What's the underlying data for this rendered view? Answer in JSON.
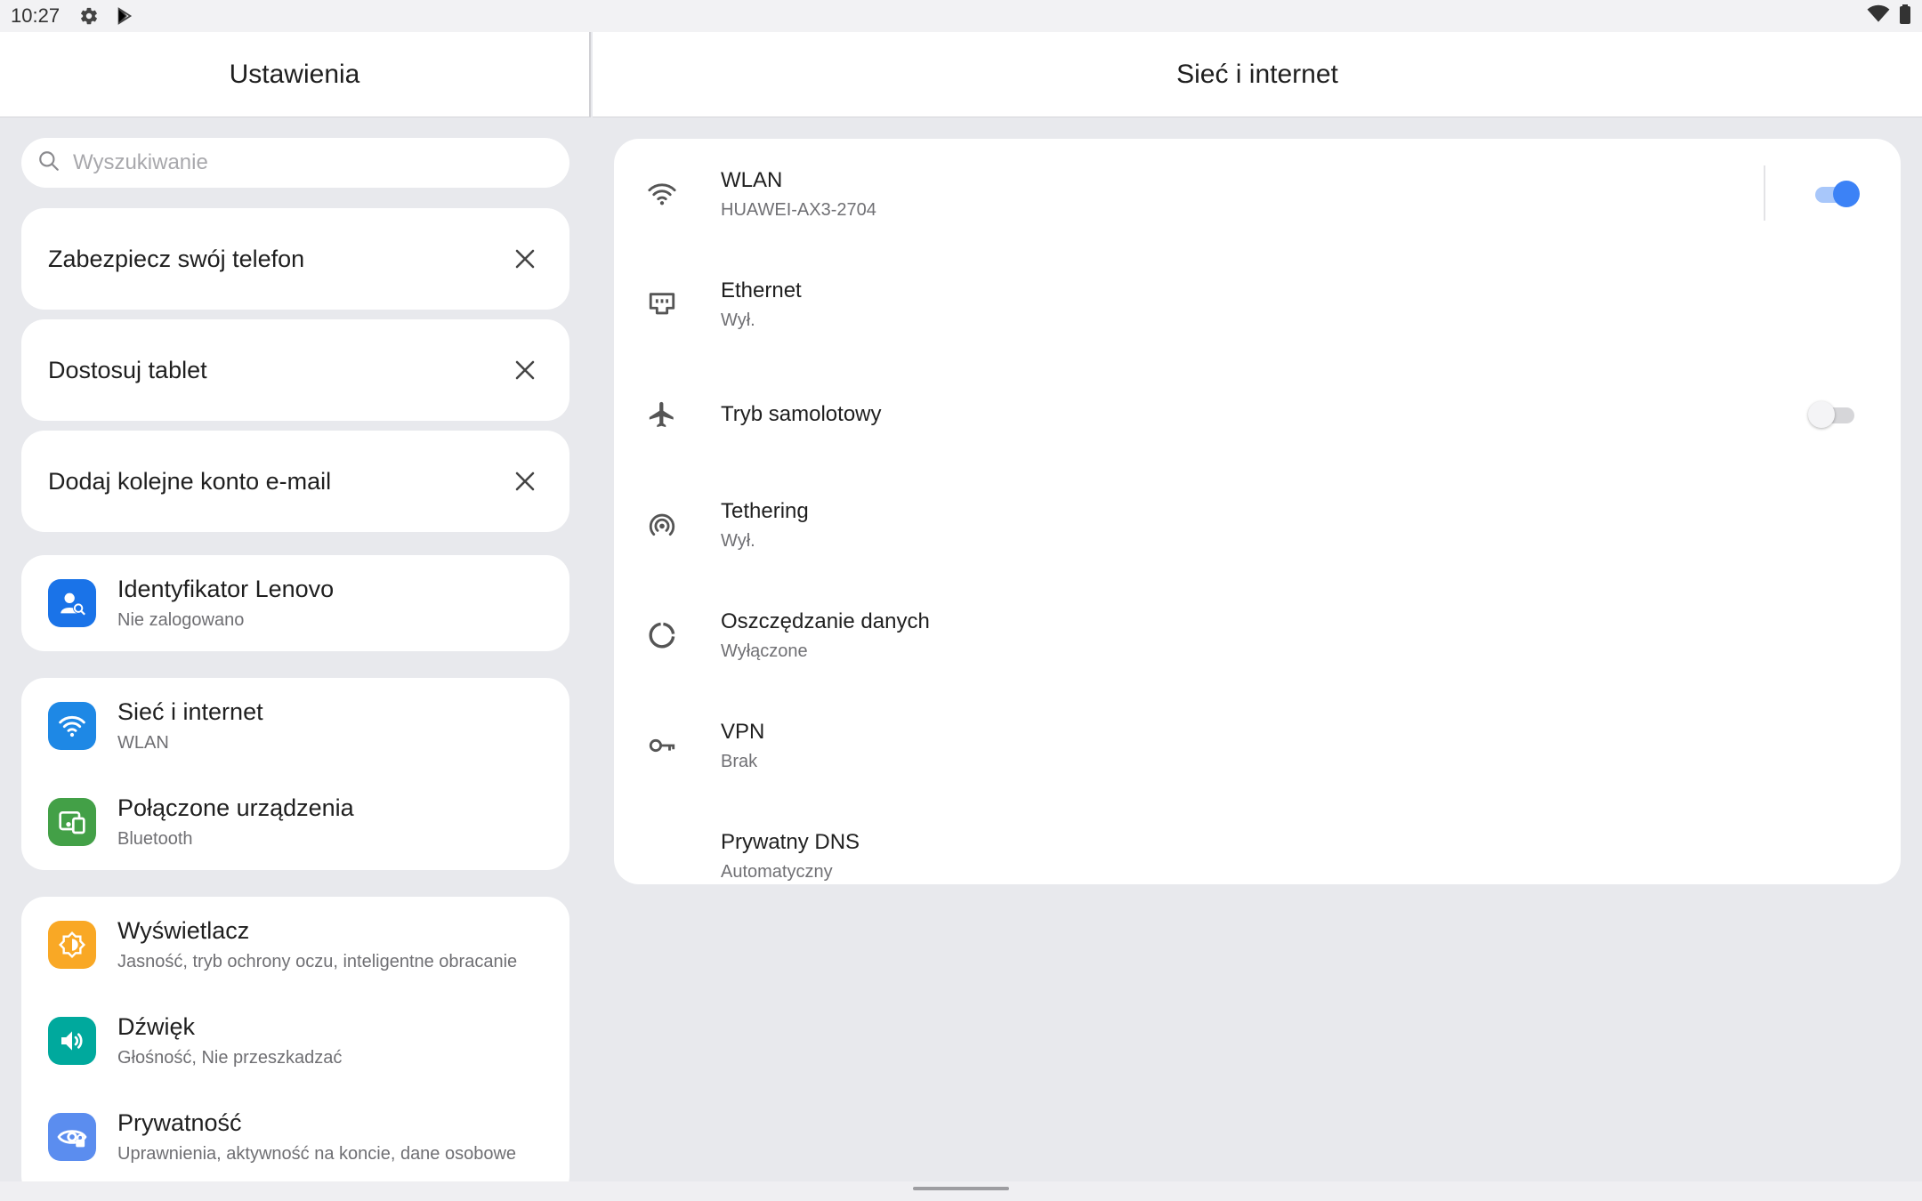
{
  "status_bar": {
    "time": "10:27",
    "icons_left": [
      "gear-icon",
      "play-store-icon"
    ],
    "icons_right": [
      "wifi-icon",
      "battery-icon"
    ]
  },
  "left_header": {
    "title": "Ustawienia"
  },
  "right_header": {
    "title": "Sieć i internet"
  },
  "search": {
    "placeholder": "Wyszukiwanie"
  },
  "suggestions": [
    {
      "label": "Zabezpiecz swój telefon"
    },
    {
      "label": "Dostosuj tablet"
    },
    {
      "label": "Dodaj kolejne konto e-mail"
    }
  ],
  "account": {
    "title": "Identyfikator Lenovo",
    "subtitle": "Nie zalogowano",
    "icon": "lenovo-id-icon",
    "color": "#1a73e8"
  },
  "group1": [
    {
      "title": "Sieć i internet",
      "subtitle": "WLAN",
      "icon": "wifi-icon",
      "color": "#1e88e5"
    },
    {
      "title": "Połączone urządzenia",
      "subtitle": "Bluetooth",
      "icon": "connected-devices-icon",
      "color": "#43a047"
    }
  ],
  "group2": [
    {
      "title": "Wyświetlacz",
      "subtitle": "Jasność, tryb ochrony oczu, inteligentne obracanie",
      "icon": "display-icon",
      "color": "#f9a825"
    },
    {
      "title": "Dźwięk",
      "subtitle": "Głośność, Nie przeszkadzać",
      "icon": "sound-icon",
      "color": "#00a99d"
    },
    {
      "title": "Prywatność",
      "subtitle": "Uprawnienia, aktywność na koncie, dane osobowe",
      "icon": "privacy-icon",
      "color": "#5b8def"
    }
  ],
  "network_items": [
    {
      "title": "WLAN",
      "subtitle": "HUAWEI-AX3-2704",
      "icon": "wifi-icon",
      "toggle": true
    },
    {
      "title": "Ethernet",
      "subtitle": "Wył.",
      "icon": "ethernet-icon"
    },
    {
      "title": "Tryb samolotowy",
      "subtitle": "",
      "icon": "airplane-icon",
      "toggle": false
    },
    {
      "title": "Tethering",
      "subtitle": "Wył.",
      "icon": "tethering-icon"
    },
    {
      "title": "Oszczędzanie danych",
      "subtitle": "Wyłączone",
      "icon": "data-saver-icon"
    },
    {
      "title": "VPN",
      "subtitle": "Brak",
      "icon": "vpn-key-icon"
    },
    {
      "title": "Prywatny DNS",
      "subtitle": "Automatyczny",
      "icon": ""
    }
  ],
  "colors": {
    "accent": "#3c82f6",
    "background": "#e8e9ed"
  }
}
